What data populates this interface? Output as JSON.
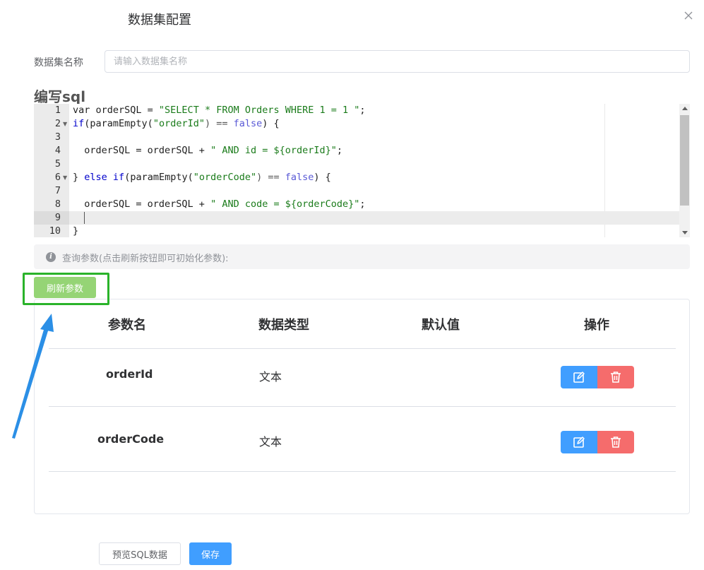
{
  "dialog": {
    "title": "数据集配置",
    "close_icon": "close-icon"
  },
  "form": {
    "name_label": "数据集名称",
    "name_placeholder": "请输入数据集名称",
    "name_value": ""
  },
  "editor": {
    "title": "编写sql",
    "active_line": 9,
    "lines": [
      {
        "num": "1",
        "fold": false
      },
      {
        "num": "2",
        "fold": true
      },
      {
        "num": "3",
        "fold": false
      },
      {
        "num": "4",
        "fold": false
      },
      {
        "num": "5",
        "fold": false
      },
      {
        "num": "6",
        "fold": true
      },
      {
        "num": "7",
        "fold": false
      },
      {
        "num": "8",
        "fold": false
      },
      {
        "num": "9",
        "fold": false
      },
      {
        "num": "10",
        "fold": false
      }
    ],
    "code": {
      "l1_a": "var orderSQL = ",
      "l1_str": "\"SELECT * FROM Orders WHERE 1 = 1 \"",
      "l1_end": ";",
      "l2_kw": "if",
      "l2_a": "(paramEmpty(",
      "l2_str": "\"orderId\"",
      "l2_b": ") == ",
      "l2_bool": "false",
      "l2_end": ") {",
      "l4_a": "  orderSQL = orderSQL + ",
      "l4_str": "\" AND id = ${orderId}\"",
      "l4_end": ";",
      "l6_a": "} ",
      "l6_kw1": "else",
      "l6_sp": " ",
      "l6_kw2": "if",
      "l6_b": "(paramEmpty(",
      "l6_str": "\"orderCode\"",
      "l6_c": ") == ",
      "l6_bool": "false",
      "l6_end": ") {",
      "l8_a": "  orderSQL = orderSQL + ",
      "l8_str": "\" AND code = ${orderCode}\"",
      "l8_end": ";",
      "l10": "}"
    }
  },
  "alert": {
    "icon": "info-icon",
    "icon_glyph": "i",
    "text": "查询参数(点击刷新按钮即可初始化参数):"
  },
  "refresh_button": "刷新参数",
  "table": {
    "headers": {
      "name": "参数名",
      "type": "数据类型",
      "default": "默认值",
      "actions": "操作"
    },
    "rows": [
      {
        "name": "orderId",
        "type": "文本",
        "default": ""
      },
      {
        "name": "orderCode",
        "type": "文本",
        "default": ""
      }
    ],
    "edit_icon": "edit-icon",
    "delete_icon": "trash-icon"
  },
  "footer": {
    "preview_label": "预览SQL数据",
    "save_label": "保存"
  },
  "colors": {
    "primary": "#409eff",
    "danger": "#f56c6c",
    "success_light": "#95d475",
    "highlight": "#2ab32a",
    "arrow": "#2b8fe6"
  }
}
